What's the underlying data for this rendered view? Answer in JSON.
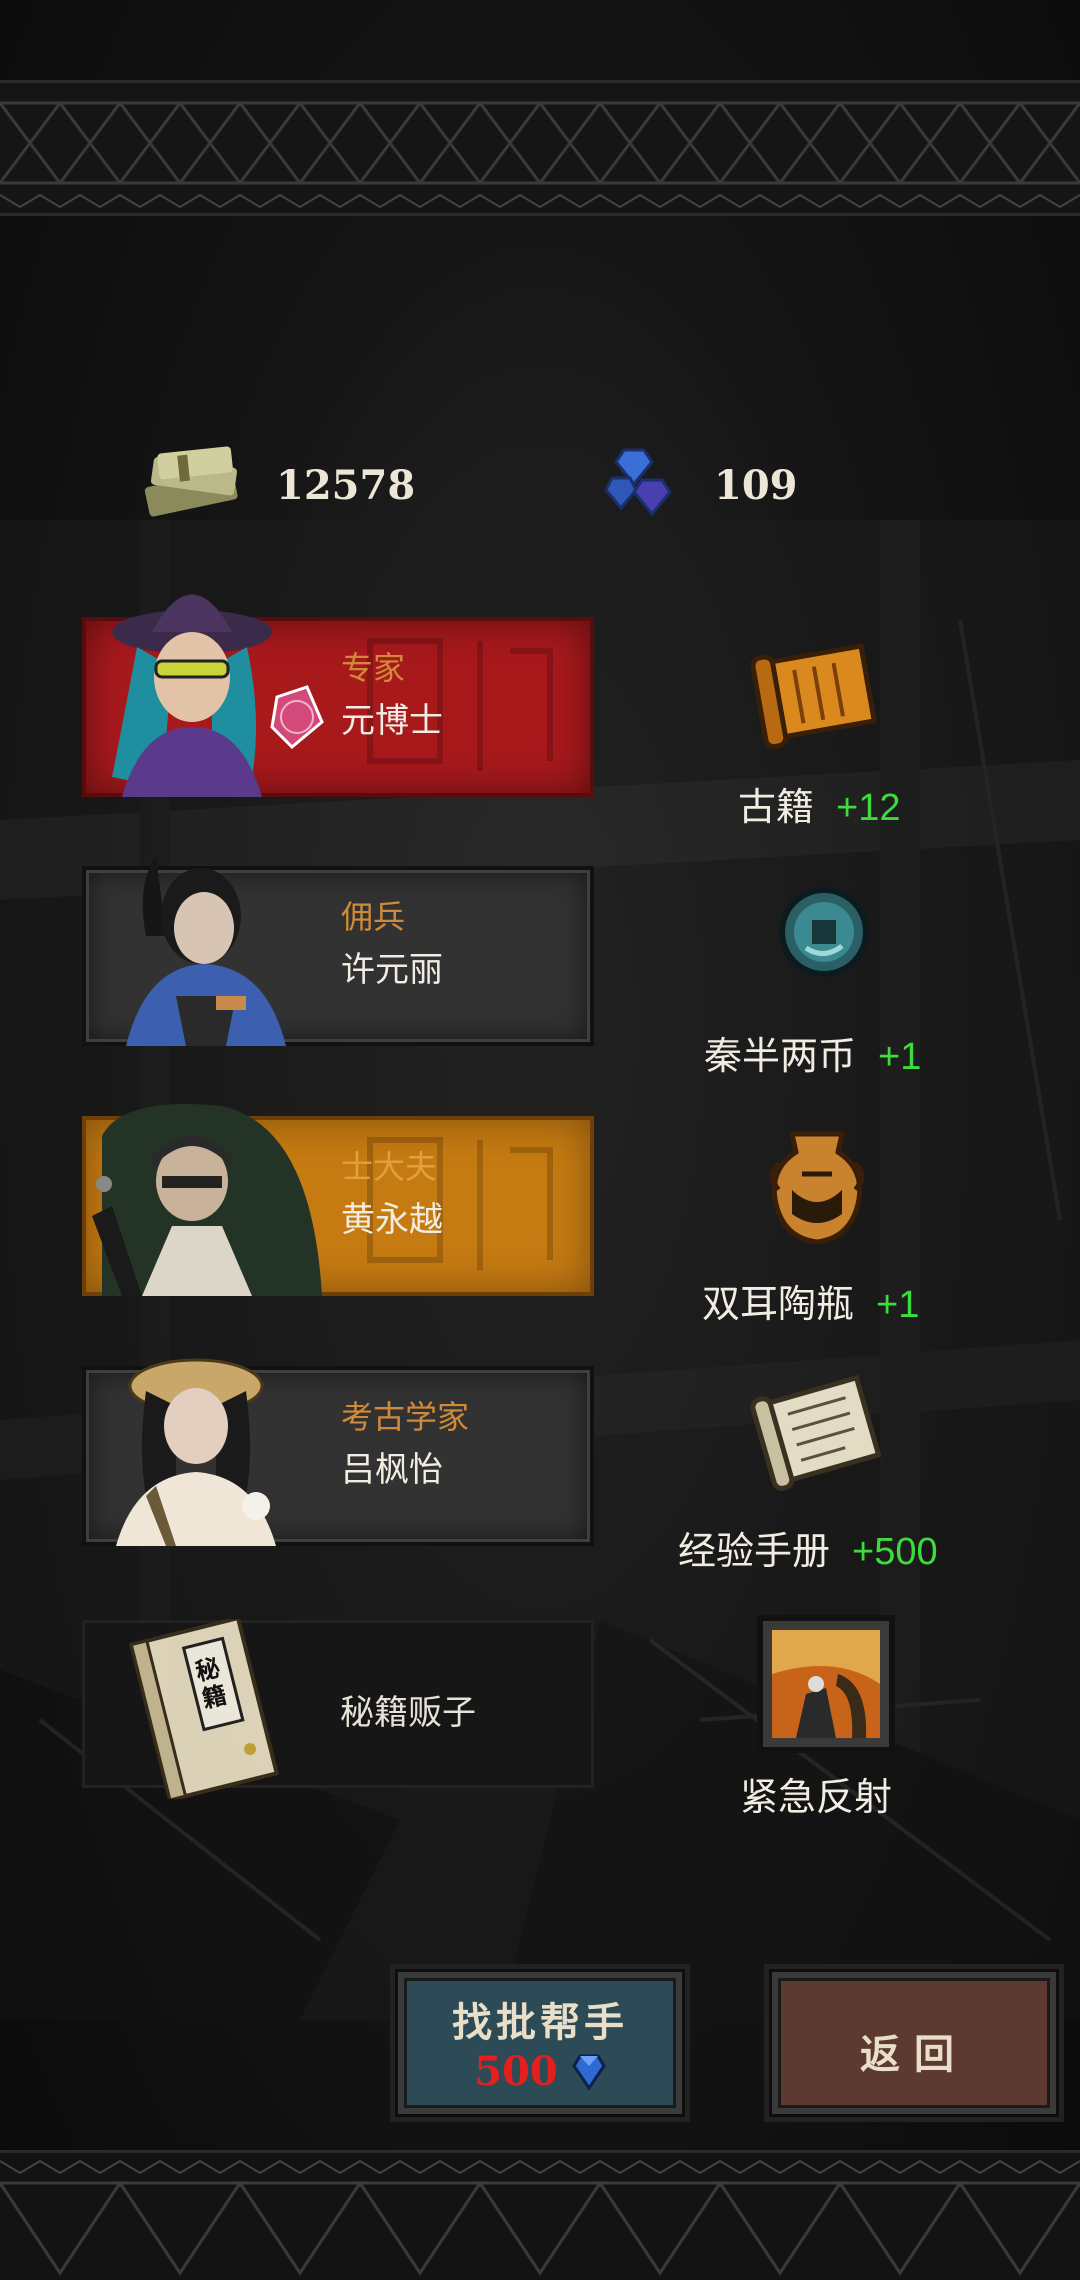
{
  "currency": {
    "money": {
      "value": "12578",
      "icon": "money-stack-icon"
    },
    "gems": {
      "value": "109",
      "icon": "blue-gem-icon"
    }
  },
  "heroes": [
    {
      "role": "专家",
      "name": "元博士",
      "frame": "red"
    },
    {
      "role": "佣兵",
      "name": "许元丽",
      "frame": "gray"
    },
    {
      "role": "士大夫",
      "name": "黄永越",
      "frame": "orange"
    },
    {
      "role": "考古学家",
      "name": "吕枫怡",
      "frame": "gray"
    },
    {
      "role": "",
      "name": "秘籍贩子",
      "frame": "dark",
      "book_text": "秘籍"
    }
  ],
  "rewards": [
    {
      "name": "古籍",
      "bonus": "+12",
      "icon": "scroll-icon"
    },
    {
      "name": "秦半两币",
      "bonus": "+1",
      "icon": "coin-icon"
    },
    {
      "name": "双耳陶瓶",
      "bonus": "+1",
      "icon": "vase-icon"
    },
    {
      "name": "经验手册",
      "bonus": "+500",
      "icon": "manual-icon"
    },
    {
      "name": "紧急反射",
      "bonus": "",
      "icon": "skill-icon"
    }
  ],
  "buttons": {
    "recruit": {
      "label": "找批帮手",
      "cost": "500",
      "cost_icon": "blue-gem-icon"
    },
    "return": {
      "label": "返回"
    }
  },
  "colors": {
    "bonus": "#3ddc3d",
    "card_red": "#a8191c",
    "card_orange": "#c57a12",
    "role_text": "#d18a3a",
    "cost": "#e51e1e"
  }
}
